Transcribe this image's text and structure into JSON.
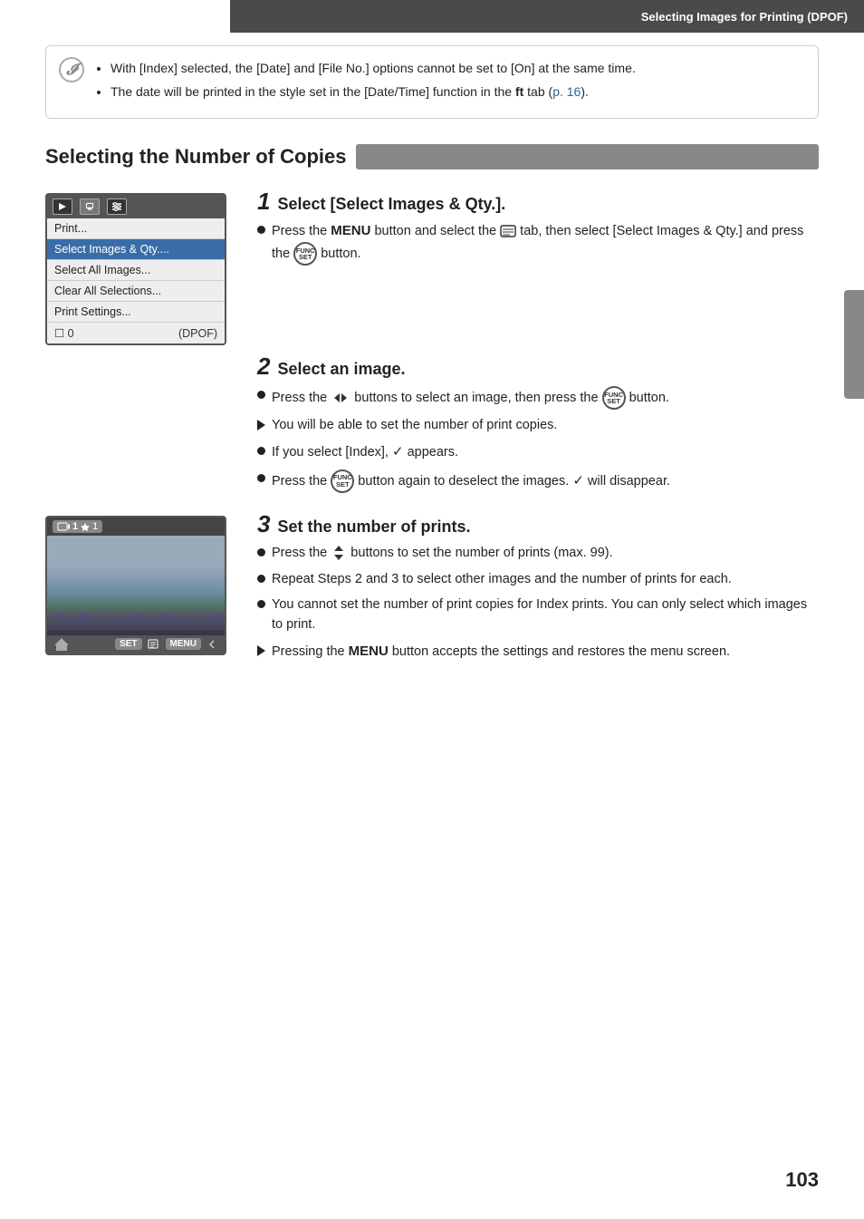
{
  "header": {
    "title": "Selecting Images for Printing (DPOF)"
  },
  "note": {
    "items": [
      "With [Index] selected, the [Date] and [File No.] options cannot be set to [On] at the same time.",
      "The date will be printed in the style set in the [Date/Time] function in the   tab (p. 16)."
    ]
  },
  "section": {
    "title": "Selecting the Number of Copies"
  },
  "steps": [
    {
      "number": "1",
      "title": "Select [Select Images & Qty.].",
      "bullets": [
        {
          "type": "circle",
          "text": "Press the MENU button and select the   tab, then select [Select Images & Qty.] and press the   button."
        }
      ]
    },
    {
      "number": "2",
      "title": "Select an image.",
      "bullets": [
        {
          "type": "circle",
          "text": "Press the   buttons to select an image, then press the   button."
        },
        {
          "type": "arrow",
          "text": "You will be able to set the number of print copies."
        },
        {
          "type": "circle",
          "text": "If you select [Index],   appears."
        },
        {
          "type": "circle",
          "text": "Press the   button again to deselect the images.   will disappear."
        }
      ]
    },
    {
      "number": "3",
      "title": "Set the number of prints.",
      "bullets": [
        {
          "type": "circle",
          "text": "Press the   buttons to set the number of prints (max. 99)."
        },
        {
          "type": "circle",
          "text": "Repeat Steps 2 and 3 to select other images and the number of prints for each."
        },
        {
          "type": "circle",
          "text": "You cannot set the number of print copies for Index prints. You can only select which images to print."
        },
        {
          "type": "arrow",
          "text": "Pressing the MENU button accepts the settings and restores the menu screen."
        }
      ]
    }
  ],
  "menu": {
    "items": [
      "Print...",
      "Select Images & Qty....",
      "Select All Images...",
      "Clear All Selections...",
      "Print Settings..."
    ],
    "footer_left": "0",
    "footer_right": "(DPOF)"
  },
  "page_number": "103"
}
